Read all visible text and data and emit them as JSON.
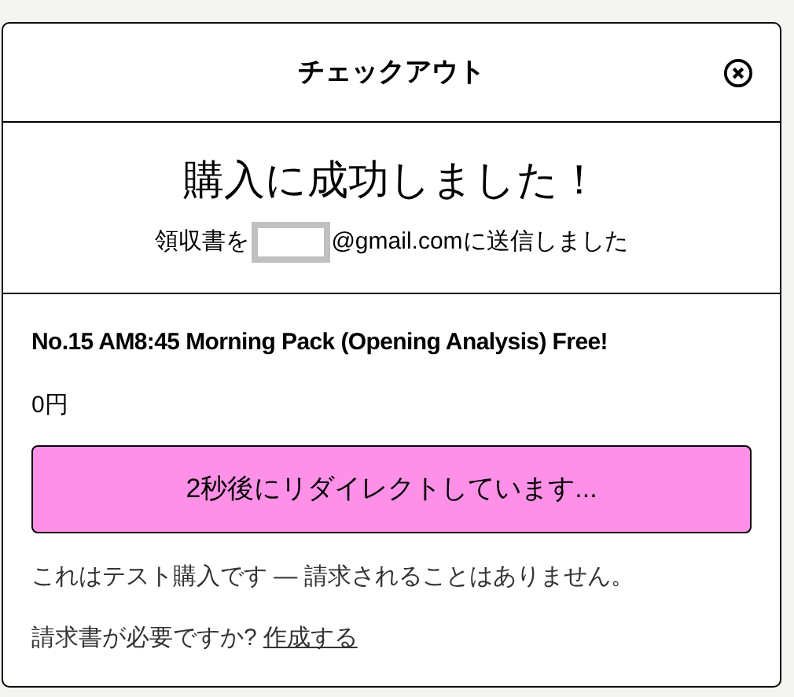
{
  "dialog": {
    "title": "チェックアウト"
  },
  "success": {
    "heading": "購入に成功しました！",
    "receipt_before": "領収書を",
    "receipt_after": "@gmail.comに送信しました"
  },
  "product": {
    "name": "No.15 AM8:45 Morning Pack (Opening Analysis) Free!",
    "price": "0円"
  },
  "redirect_button": "2秒後にリダイレクトしています...",
  "test_notice": "これはテスト購入です — 請求されることはありません。",
  "invoice": {
    "question": "請求書が必要ですか?",
    "link": "作成する"
  }
}
